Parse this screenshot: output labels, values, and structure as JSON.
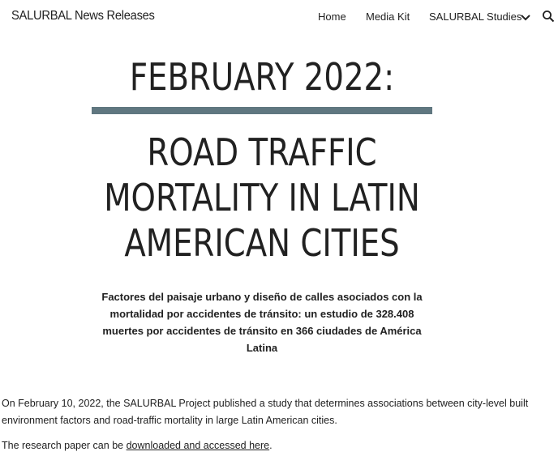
{
  "header": {
    "site_title": "SALURBAL News Releases",
    "nav": {
      "home": "Home",
      "media_kit": "Media Kit",
      "studies": "SALURBAL Studies"
    },
    "icons": {
      "chevron": "chevron-down-icon",
      "search": "search-icon"
    }
  },
  "main": {
    "date_heading": "FEBRUARY 2022:",
    "title_lines": [
      "ROAD TRAFFIC",
      "MORTALITY IN LATIN",
      "AMERICAN CITIES"
    ],
    "subtitle": "Factores del paisaje urbano y diseño de calles asociados con la mortalidad por accidentes de tránsito: un estudio de 328.408 muertes por accidentes de tránsito en 366 ciudades de América Latina",
    "paragraph_1": "On February 10, 2022, the SALURBAL Project published a study that determines associations between city-level built environment factors and road-traffic mortality in large Latin American cities.",
    "paragraph_2_prefix": "The research paper can be ",
    "paragraph_2_link": "downloaded and accessed here",
    "paragraph_2_suffix": "."
  },
  "colors": {
    "divider": "#607780",
    "text": "#212121",
    "background": "#ffffff"
  }
}
